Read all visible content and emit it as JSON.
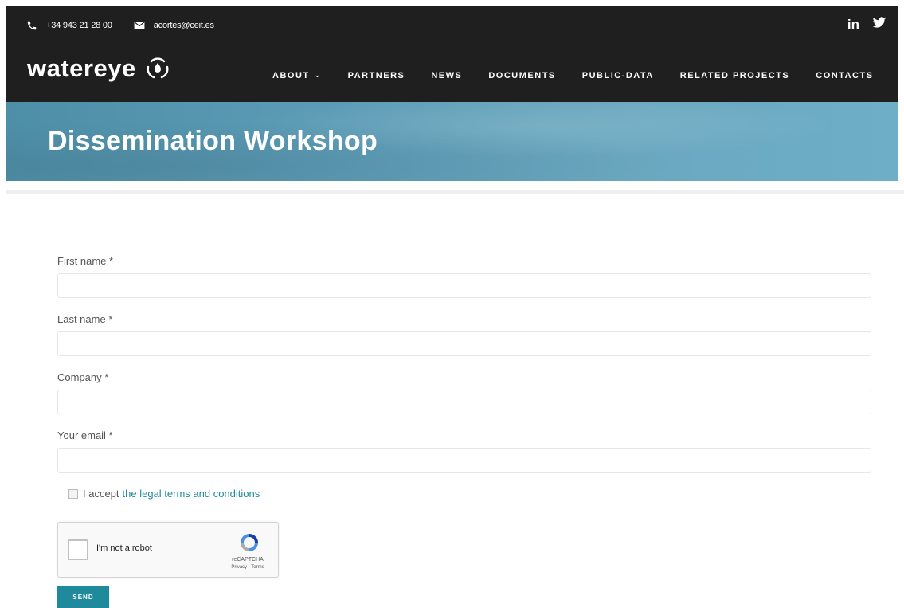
{
  "topbar": {
    "phone": "+34 943 21 28 00",
    "email": "acortes@ceit.es",
    "social": [
      {
        "name": "linkedin",
        "label": "in"
      },
      {
        "name": "twitter",
        "label": "🐦"
      }
    ]
  },
  "brand": {
    "logo_text": "watereye"
  },
  "nav": {
    "items": [
      {
        "label": "ABOUT",
        "has_dropdown": true
      },
      {
        "label": "PARTNERS"
      },
      {
        "label": "NEWS"
      },
      {
        "label": "DOCUMENTS"
      },
      {
        "label": "PUBLIC-DATA"
      },
      {
        "label": "RELATED PROJECTS"
      },
      {
        "label": "CONTACTS"
      }
    ]
  },
  "hero": {
    "title": "Dissemination Workshop"
  },
  "form": {
    "fields": [
      {
        "label": "First name *",
        "value": ""
      },
      {
        "label": "Last name *",
        "value": ""
      },
      {
        "label": "Company *",
        "value": ""
      },
      {
        "label": "Your email *",
        "value": ""
      }
    ],
    "accept_prefix": "I accept",
    "accept_link": "the legal terms and conditions",
    "captcha": {
      "label": "I'm not a robot",
      "brand": "reCAPTCHA",
      "links": "Privacy - Terms"
    },
    "submit_label": "SEND"
  },
  "colors": {
    "accent": "#1f8a9c",
    "dark": "#1f1f1f"
  }
}
